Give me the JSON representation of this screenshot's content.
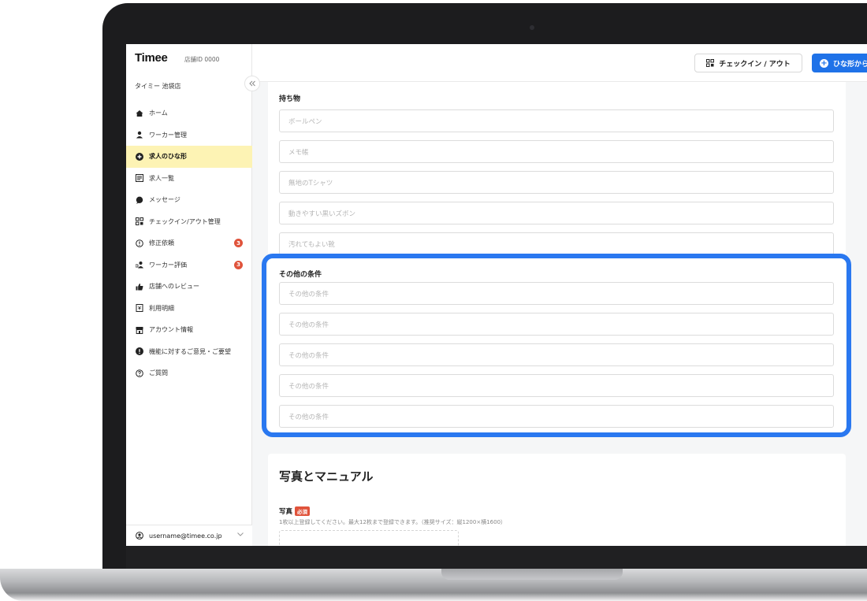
{
  "app": {
    "logo": "Timee",
    "store_id": "店舗ID 0000",
    "store_name": "タイミー 池袋店"
  },
  "sidebar": {
    "items": [
      {
        "label": "ホーム",
        "icon": "home-icon",
        "active": false
      },
      {
        "label": "ワーカー管理",
        "icon": "user-icon",
        "active": false
      },
      {
        "label": "求人のひな形",
        "icon": "plus-circle-icon",
        "active": true
      },
      {
        "label": "求人一覧",
        "icon": "list-icon",
        "active": false
      },
      {
        "label": "メッセージ",
        "icon": "chat-icon",
        "active": false
      },
      {
        "label": "チェックイン/アウト管理",
        "icon": "qr-icon",
        "active": false
      },
      {
        "label": "修正依頼",
        "icon": "alert-circle-icon",
        "active": false,
        "badge": "3"
      },
      {
        "label": "ワーカー評価",
        "icon": "rating-icon",
        "active": false,
        "badge": "3"
      },
      {
        "label": "店舗へのレビュー",
        "icon": "thumbs-up-icon",
        "active": false
      },
      {
        "label": "利用明細",
        "icon": "invoice-icon",
        "active": false
      },
      {
        "label": "アカウント情報",
        "icon": "store-icon",
        "active": false
      },
      {
        "label": "機能に対するご意見・ご要望",
        "icon": "exclamation-icon",
        "active": false
      },
      {
        "label": "ご質問",
        "icon": "question-icon",
        "active": false
      }
    ],
    "user_email": "username@timee.co.jp"
  },
  "header": {
    "checkin_button": "チェックイン / アウト",
    "template_button": "ひな形から"
  },
  "form": {
    "belongings": {
      "label": "持ち物",
      "placeholders": [
        "ボールペン",
        "メモ帳",
        "無地のTシャツ",
        "動きやすい黒いズボン",
        "汚れてもよい靴"
      ]
    },
    "other_conditions": {
      "label": "その他の条件",
      "placeholders": [
        "その他の条件",
        "その他の条件",
        "その他の条件",
        "その他の条件",
        "その他の条件"
      ]
    }
  },
  "photos": {
    "title": "写真とマニュアル",
    "photo_label": "写真",
    "required_badge": "必須",
    "hint": "1枚以上登録してください。最大12枚まで登録できます。（推奨サイズ：縦1200×横1600）"
  },
  "colors": {
    "accent": "#1f72e8",
    "highlight": "#2a78f0",
    "active_nav": "#fdf3b4",
    "badge": "#e0533b"
  }
}
